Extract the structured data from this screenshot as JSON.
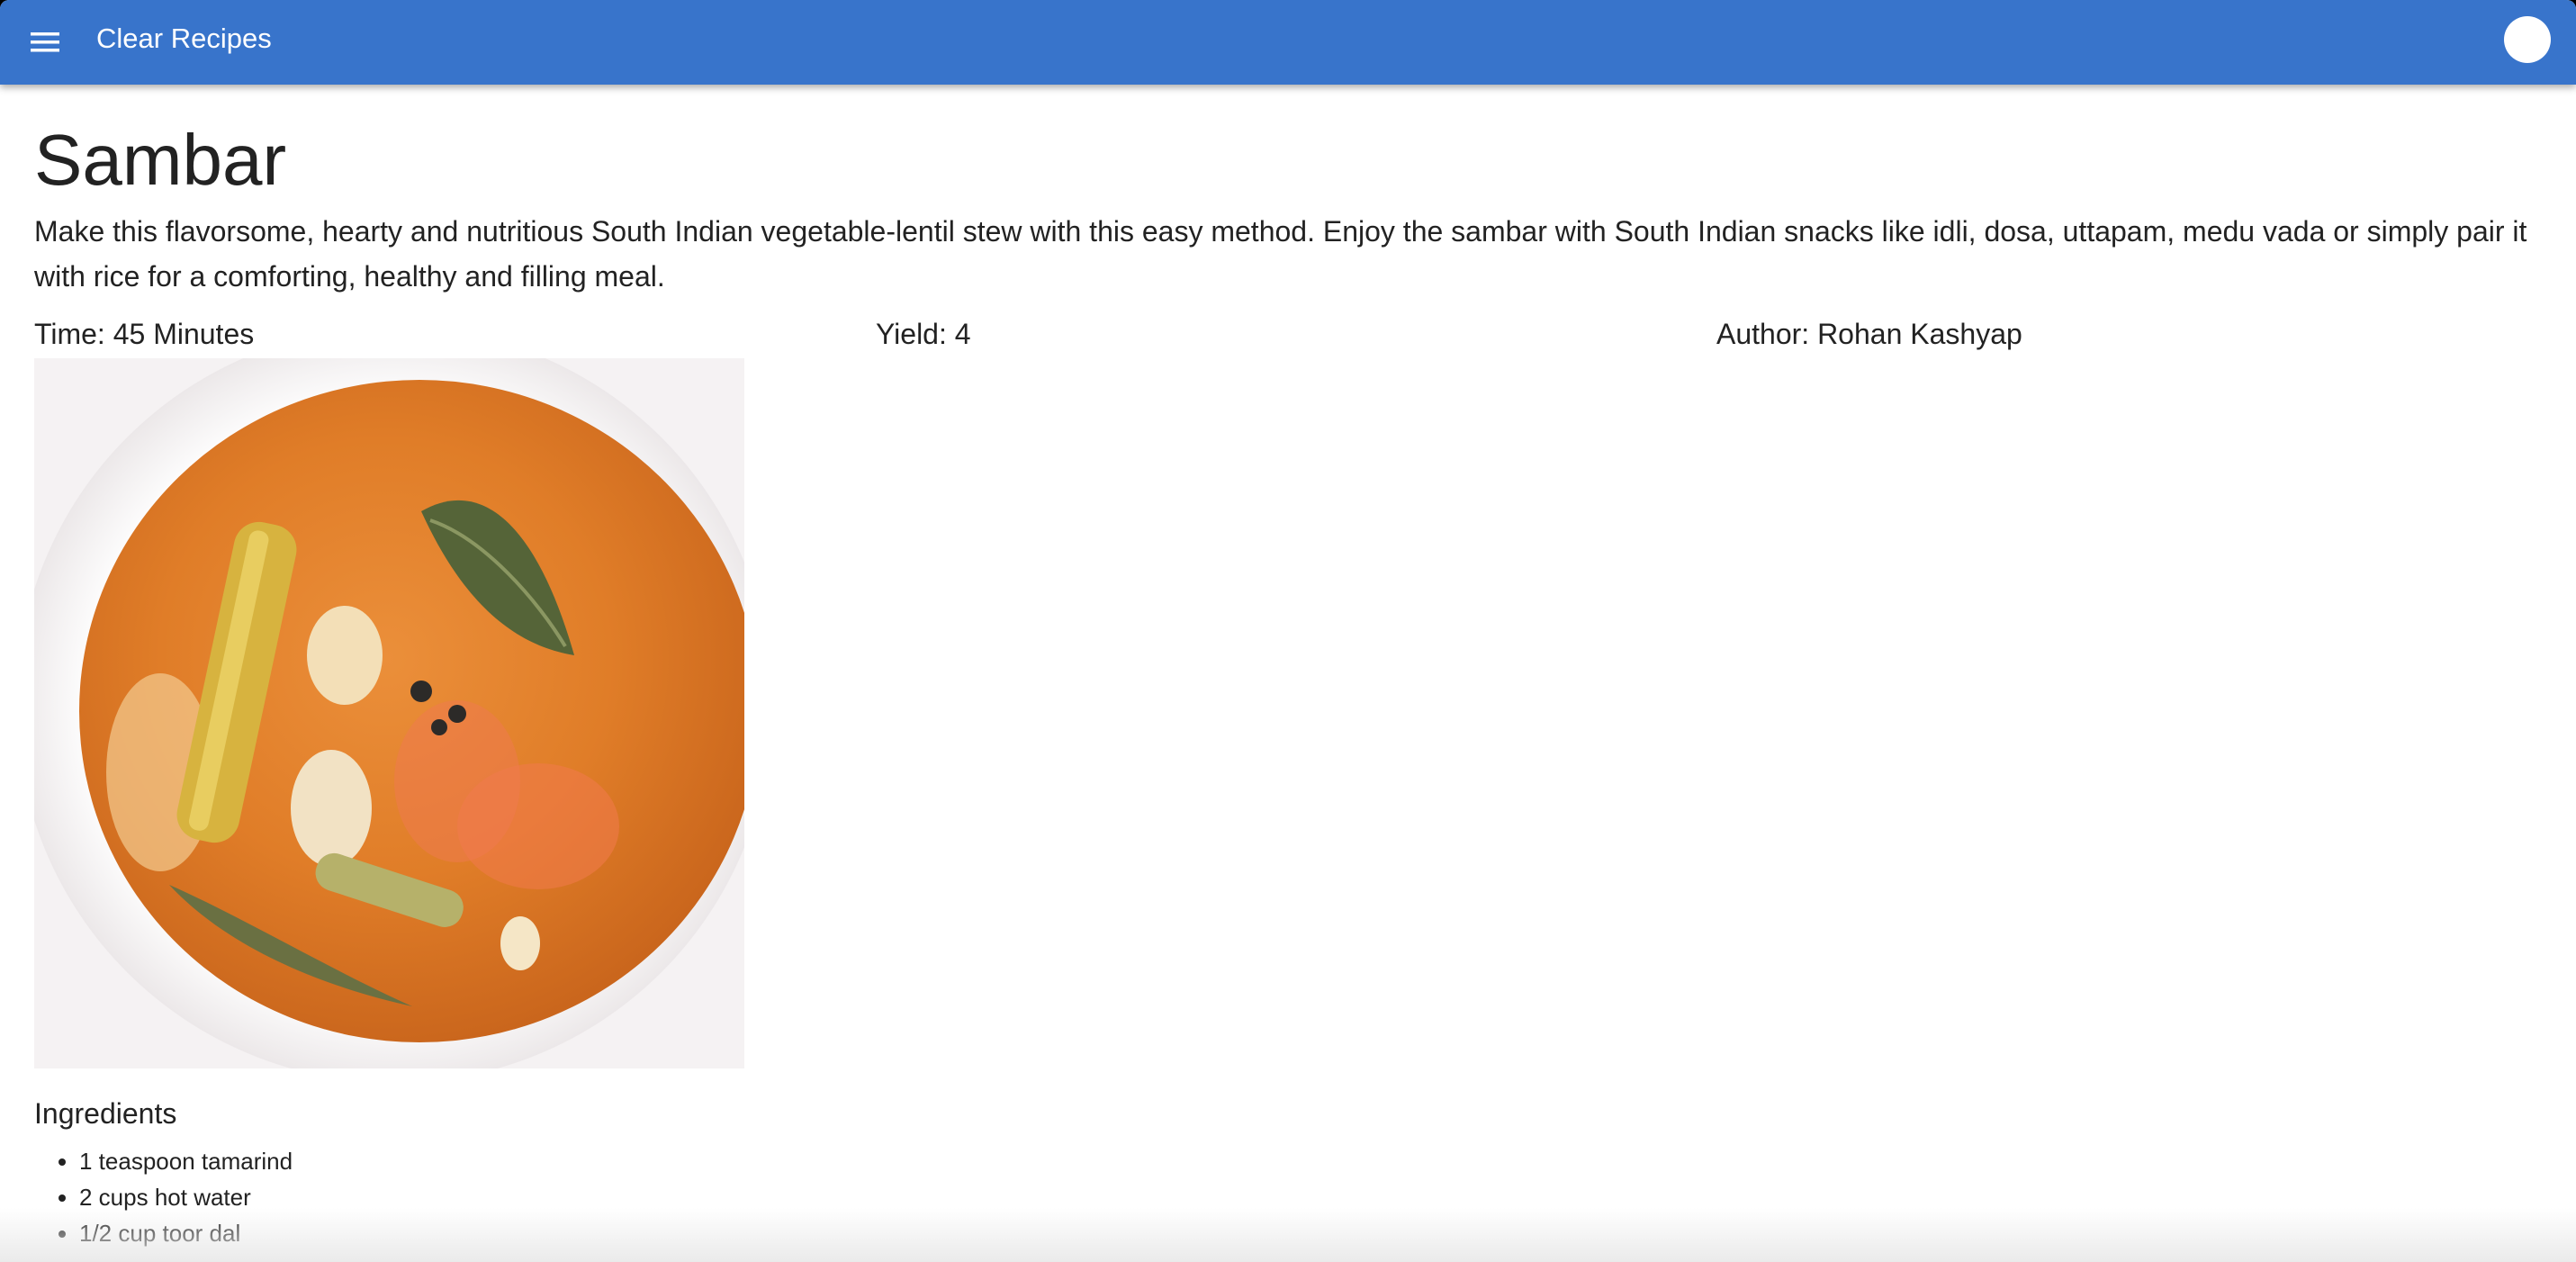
{
  "appbar": {
    "title": "Clear Recipes",
    "menu_icon": "hamburger-menu-icon",
    "avatar_icon": "avatar-circle",
    "color": "#3874cb"
  },
  "recipe": {
    "title": "Sambar",
    "description": "Make this flavorsome, hearty and nutritious South Indian vegetable-lentil stew with this easy method. Enjoy the sambar with South Indian snacks like idli, dosa, uttapam, medu vada or simply pair it with rice for a comforting, healthy and filling meal.",
    "time": "Time: 45 Minutes",
    "yield": "Yield: 4",
    "author": "Author: Rohan Kashyap",
    "ingredients_heading": "Ingredients",
    "ingredients": [
      "1 teaspoon tamarind",
      "2 cups hot water",
      "1/2 cup toor dal"
    ]
  }
}
